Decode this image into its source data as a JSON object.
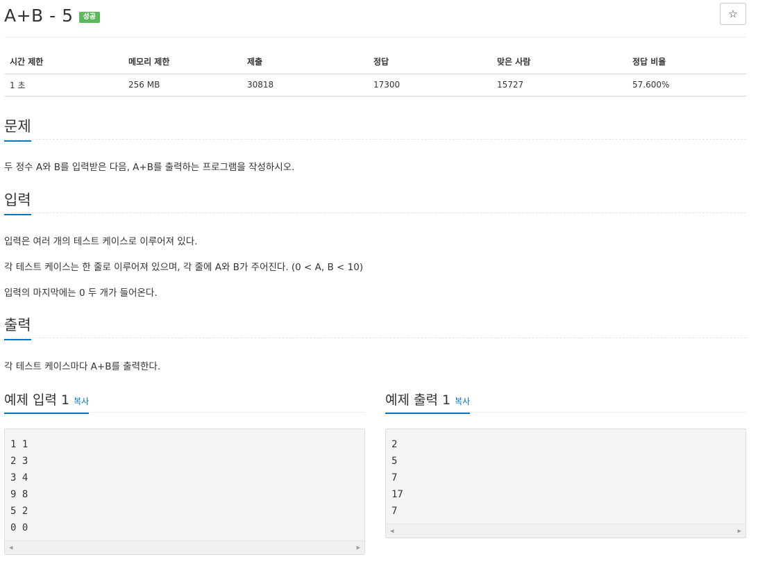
{
  "problem": {
    "title": "A+B - 5",
    "status_badge": "성공",
    "star_icon": "☆"
  },
  "info_table": {
    "headers": [
      "시간 제한",
      "메모리 제한",
      "제출",
      "정답",
      "맞은 사람",
      "정답 비율"
    ],
    "values": [
      "1 초",
      "256 MB",
      "30818",
      "17300",
      "15727",
      "57.600%"
    ]
  },
  "sections": {
    "problem_heading": "문제",
    "problem_text": "두 정수 A와 B를 입력받은 다음, A+B를 출력하는 프로그램을 작성하시오.",
    "input_heading": "입력",
    "input_lines": [
      "입력은 여러 개의 테스트 케이스로 이루어져 있다.",
      "각 테스트 케이스는 한 줄로 이루어져 있으며, 각 줄에 A와 B가 주어진다. (0 < A, B < 10)",
      "입력의 마지막에는 0 두 개가 들어온다."
    ],
    "output_heading": "출력",
    "output_text": "각 테스트 케이스마다 A+B를 출력한다."
  },
  "samples": {
    "input_title": "예제 입력 1",
    "output_title": "예제 출력 1",
    "copy_label": "복사",
    "input_lines": [
      "1 1",
      "2 3",
      "3 4",
      "9 8",
      "5 2",
      "0 0"
    ],
    "output_lines": [
      "2",
      "5",
      "7",
      "17",
      "7"
    ]
  }
}
